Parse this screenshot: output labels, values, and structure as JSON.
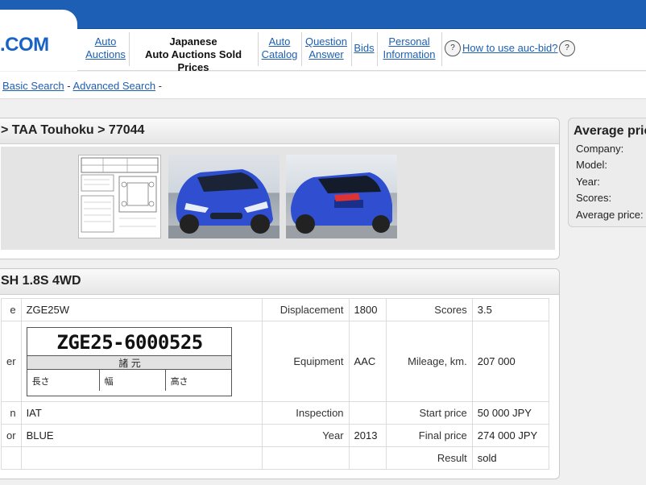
{
  "app": {
    "logo": ".COM"
  },
  "nav": {
    "auto_auctions": [
      "Auto",
      "Auctions"
    ],
    "sold_prices": [
      "Japanese",
      "Auto Auctions Sold Prices"
    ],
    "auto_catalog": [
      "Auto",
      "Catalog"
    ],
    "question_answer": [
      "Question",
      "Answer"
    ],
    "bids": "Bids",
    "personal_info": [
      "Personal",
      "Information"
    ],
    "how_to_use": "How to use auc-bid?"
  },
  "search": {
    "basic": "Basic Search",
    "sep1": " - ",
    "advanced": "Advanced Search",
    "sep2": " -"
  },
  "breadcrumb": "> TAA Touhoku > 77044",
  "lot": {
    "title": "SH 1.8S 4WD"
  },
  "specs": {
    "row1": {
      "label": "e",
      "value": "ZGE25W",
      "displacement_label": "Displacement",
      "displacement": "1800",
      "scores_label": "Scores",
      "scores": "3.5"
    },
    "row2": {
      "label": "er",
      "plate_number": "ZGE25-6000525",
      "plate_header": "諸 元",
      "plate_cells": [
        "長さ",
        "幅",
        "高さ"
      ],
      "equipment_label": "Equipment",
      "equipment": "AAC",
      "mileage_label": "Mileage, km.",
      "mileage": "207 000"
    },
    "row3": {
      "label": "n",
      "value": "IAT",
      "inspection_label": "Inspection",
      "inspection": "",
      "start_price_label": "Start price",
      "start_price": "50 000 JPY"
    },
    "row4": {
      "label": "or",
      "value": "BLUE",
      "year_label": "Year",
      "year": "2013",
      "final_price_label": "Final price",
      "final_price": "274 000 JPY"
    },
    "row5": {
      "result_label": "Result",
      "result": "sold"
    }
  },
  "average": {
    "title": "Average pric",
    "company_label": "Company:",
    "model_label": "Model:",
    "year_label": "Year:",
    "scores_label": "Scores:",
    "price_label": "Average price:"
  },
  "colors": {
    "brand": "#1d5fb4",
    "car": "#2f4fd0"
  }
}
